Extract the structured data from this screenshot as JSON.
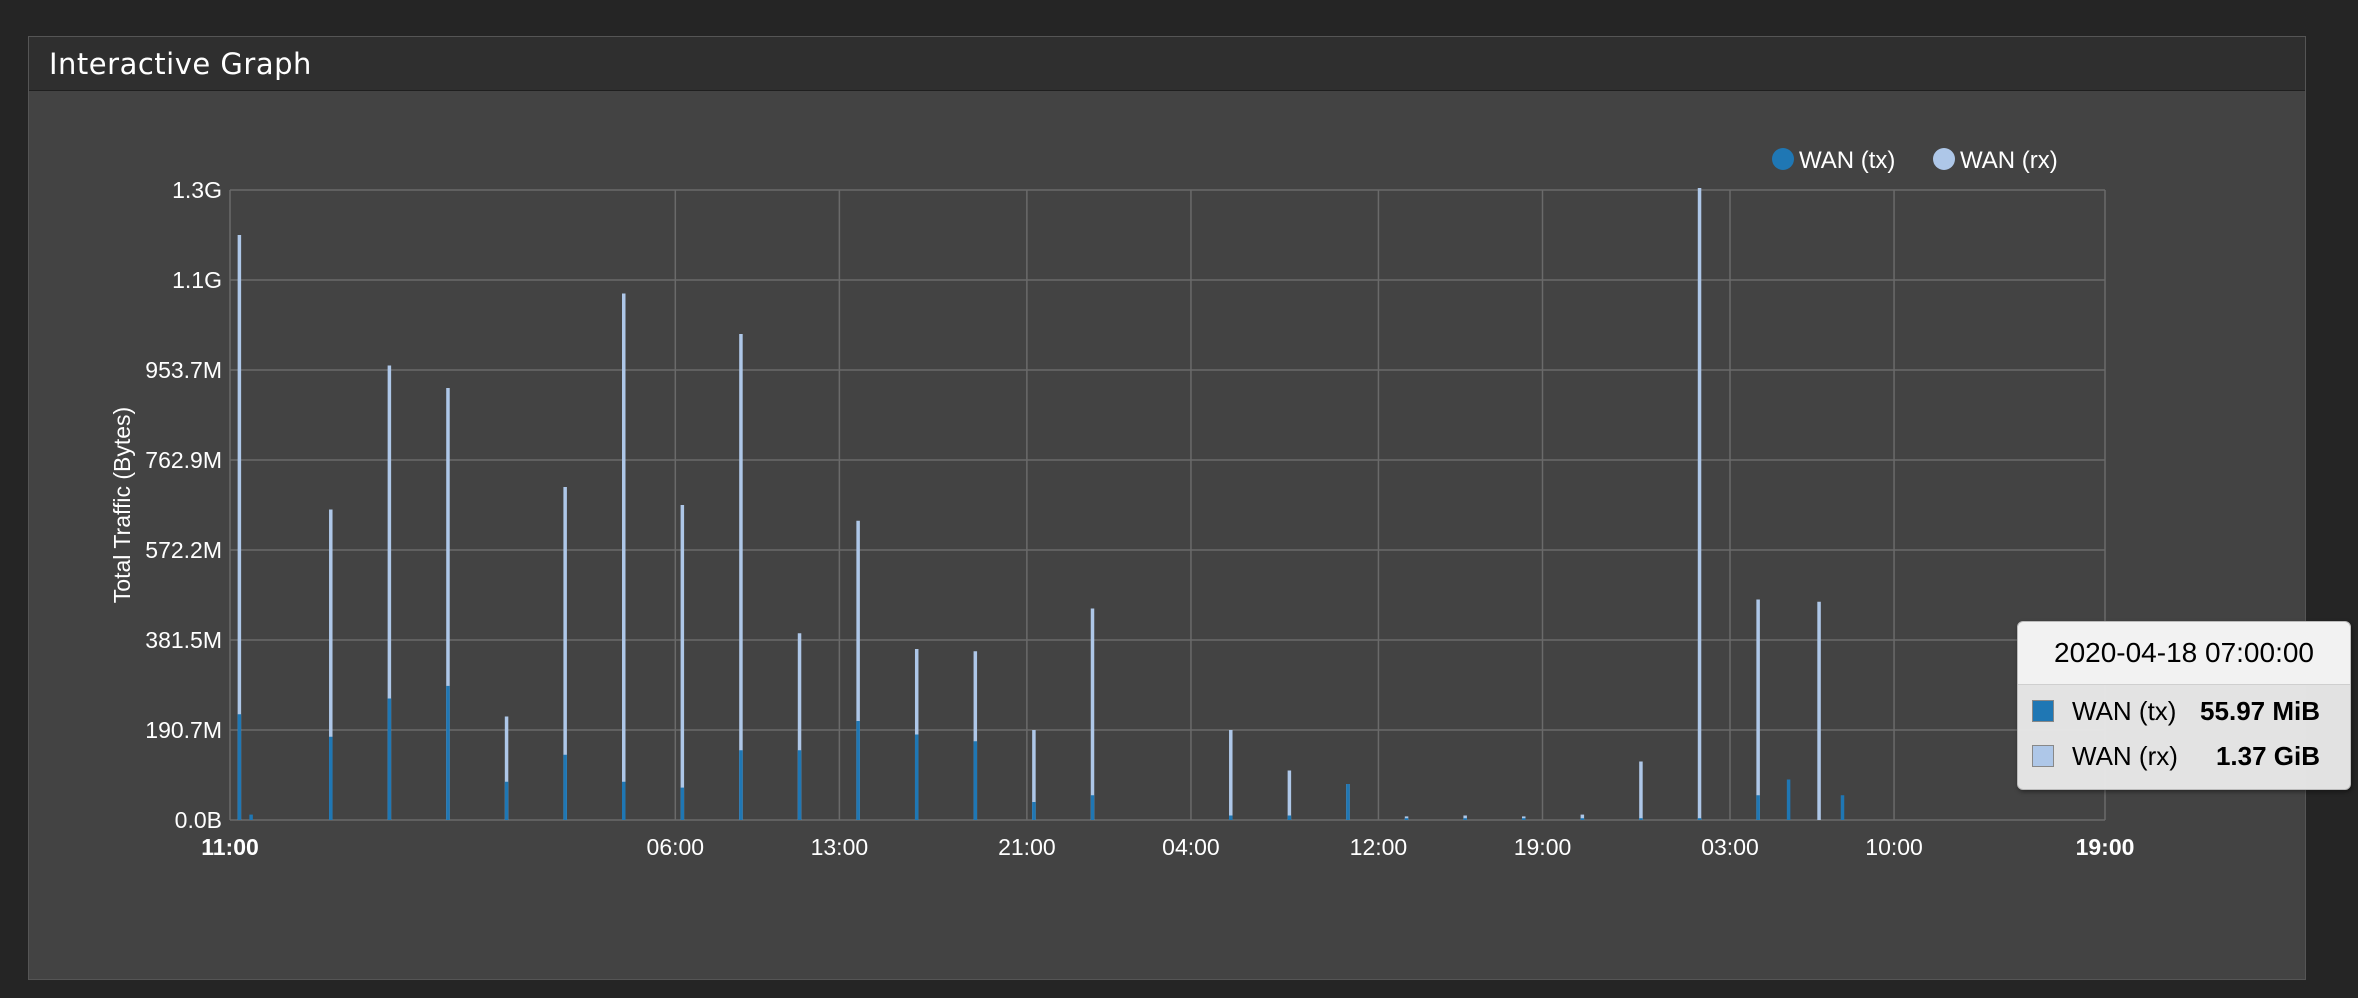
{
  "panel": {
    "title": "Interactive Graph"
  },
  "colors": {
    "tx": "#1f77b4",
    "rx": "#aec7e8",
    "grid": "#6a6a6a",
    "axis_text": "#ffffff"
  },
  "tooltip": {
    "header": "2020-04-18 07:00:00",
    "rows": [
      {
        "label": "WAN (tx)",
        "value": "55.97 MiB",
        "color": "#1f77b4"
      },
      {
        "label": "WAN (rx)",
        "value": "1.37 GiB",
        "color": "#aec7e8"
      }
    ]
  },
  "chart_data": {
    "type": "bar",
    "ylabel": "Total Traffic (Bytes)",
    "xlabel": "",
    "yticks": [
      "0.0B",
      "190.7M",
      "381.5M",
      "572.2M",
      "762.9M",
      "953.7M",
      "1.1G",
      "1.3G"
    ],
    "ylim": [
      0,
      1.4
    ],
    "y_unit": "GB",
    "xticks": [
      {
        "label": "11:00",
        "hour": 0,
        "bold": true
      },
      {
        "label": "06:00",
        "hour": 19
      },
      {
        "label": "13:00",
        "hour": 26
      },
      {
        "label": "21:00",
        "hour": 34
      },
      {
        "label": "04:00",
        "hour": 41
      },
      {
        "label": "12:00",
        "hour": 49
      },
      {
        "label": "19:00",
        "hour": 56
      },
      {
        "label": "03:00",
        "hour": 64
      },
      {
        "label": "10:00",
        "hour": 71
      },
      {
        "label": "19:00",
        "hour": 80,
        "bold": true
      }
    ],
    "x_range_hours": [
      0,
      80
    ],
    "legend": {
      "position": "top-right"
    },
    "series": [
      {
        "name": "WAN (tx)",
        "data": [
          [
            0.4,
            0.235
          ],
          [
            0.9,
            0.012
          ],
          [
            4.3,
            0.185
          ],
          [
            6.8,
            0.27
          ],
          [
            9.3,
            0.298
          ],
          [
            11.8,
            0.085
          ],
          [
            14.3,
            0.145
          ],
          [
            16.8,
            0.085
          ],
          [
            19.3,
            0.072
          ],
          [
            21.8,
            0.155
          ],
          [
            24.3,
            0.155
          ],
          [
            26.8,
            0.22
          ],
          [
            29.3,
            0.19
          ],
          [
            31.8,
            0.175
          ],
          [
            34.3,
            0.04
          ],
          [
            36.8,
            0.055
          ],
          [
            42.7,
            0.01
          ],
          [
            45.2,
            0.01
          ],
          [
            47.7,
            0.08
          ],
          [
            50.2,
            0.004
          ],
          [
            52.7,
            0.004
          ],
          [
            55.2,
            0.004
          ],
          [
            57.7,
            0.004
          ],
          [
            60.2,
            0.004
          ],
          [
            62.7,
            0.004
          ],
          [
            65.2,
            0.055
          ],
          [
            66.5,
            0.09
          ],
          [
            68.8,
            0.055
          ]
        ]
      },
      {
        "name": "WAN (rx)",
        "data": [
          [
            0.4,
            1.3
          ],
          [
            4.3,
            0.69
          ],
          [
            6.8,
            1.01
          ],
          [
            9.3,
            0.96
          ],
          [
            11.8,
            0.23
          ],
          [
            14.3,
            0.74
          ],
          [
            16.8,
            1.17
          ],
          [
            19.3,
            0.7
          ],
          [
            21.8,
            1.08
          ],
          [
            24.3,
            0.415
          ],
          [
            26.8,
            0.665
          ],
          [
            29.3,
            0.38
          ],
          [
            31.8,
            0.375
          ],
          [
            34.3,
            0.2
          ],
          [
            36.8,
            0.47
          ],
          [
            42.7,
            0.2
          ],
          [
            45.2,
            0.11
          ],
          [
            47.7,
            0.08
          ],
          [
            50.2,
            0.008
          ],
          [
            52.7,
            0.01
          ],
          [
            55.2,
            0.008
          ],
          [
            57.7,
            0.012
          ],
          [
            60.2,
            0.13
          ],
          [
            62.7,
            1.47
          ],
          [
            65.2,
            0.49
          ],
          [
            67.8,
            0.485
          ]
        ]
      }
    ]
  }
}
